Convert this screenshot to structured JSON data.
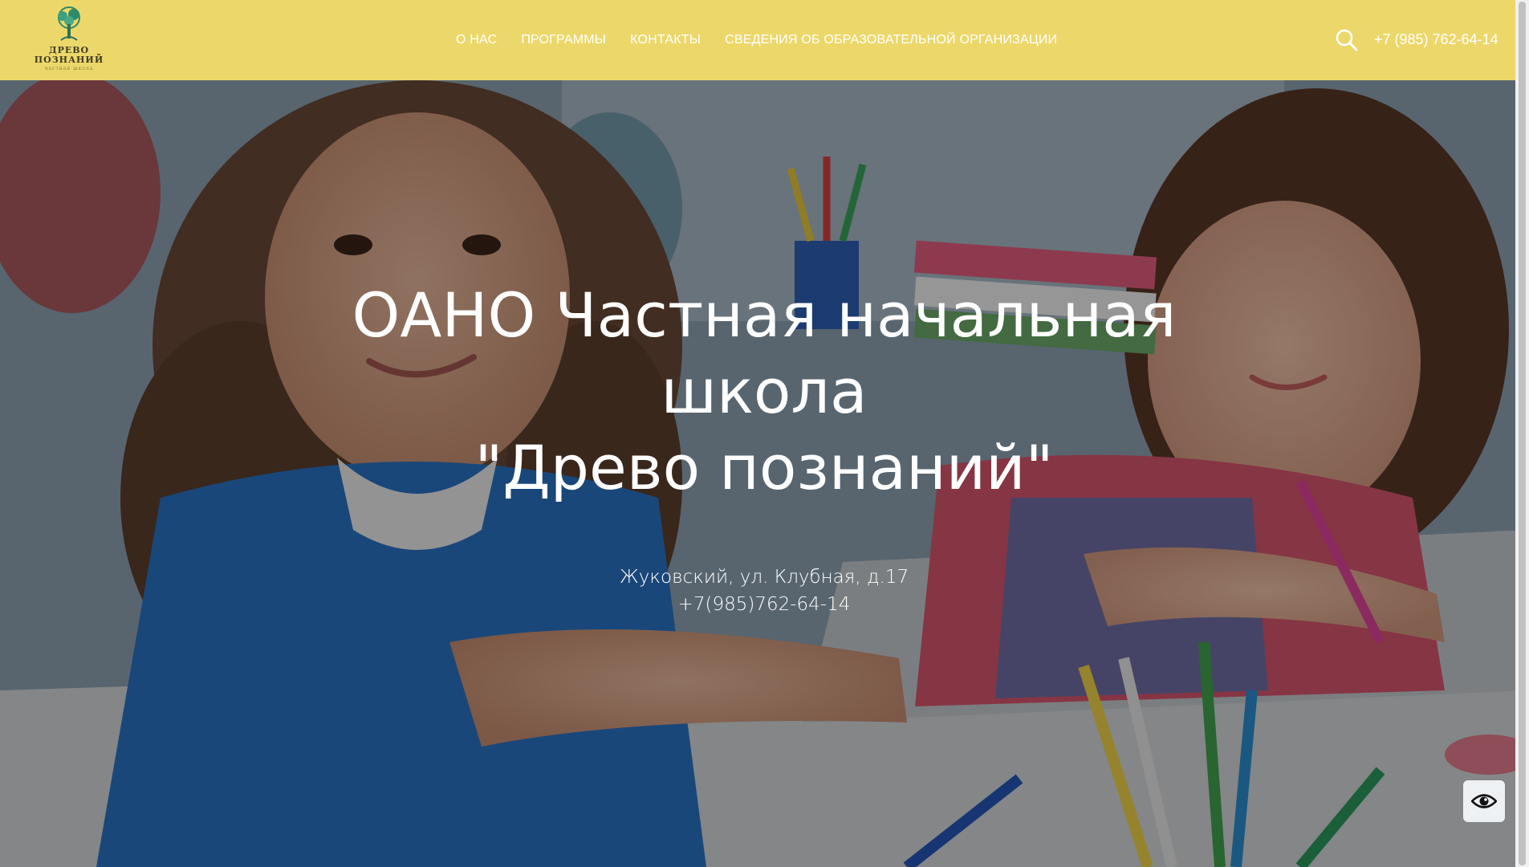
{
  "header": {
    "logo": {
      "line1": "ДРЕВО",
      "line2": "ПОЗНАНИЙ",
      "line3": "частная школа"
    },
    "nav": [
      {
        "label": "О НАС"
      },
      {
        "label": "ПРОГРАММЫ"
      },
      {
        "label": "КОНТАКТЫ"
      },
      {
        "label": "СВЕДЕНИЯ ОБ ОБРАЗОВАТЕЛЬНОЙ ОРГАНИЗАЦИИ"
      }
    ],
    "search_icon": "search-icon",
    "phone": "+7 (985) 762-64-14",
    "background_color": "#ecd86a"
  },
  "hero": {
    "title_lines": [
      "ОАНО Частная начальная",
      "школа",
      "\"Древо познаний\""
    ],
    "address": "Жуковский, ул. Клубная, д.17",
    "phone": "+7(985)762-64-14"
  },
  "accessibility": {
    "icon": "eye-icon"
  }
}
